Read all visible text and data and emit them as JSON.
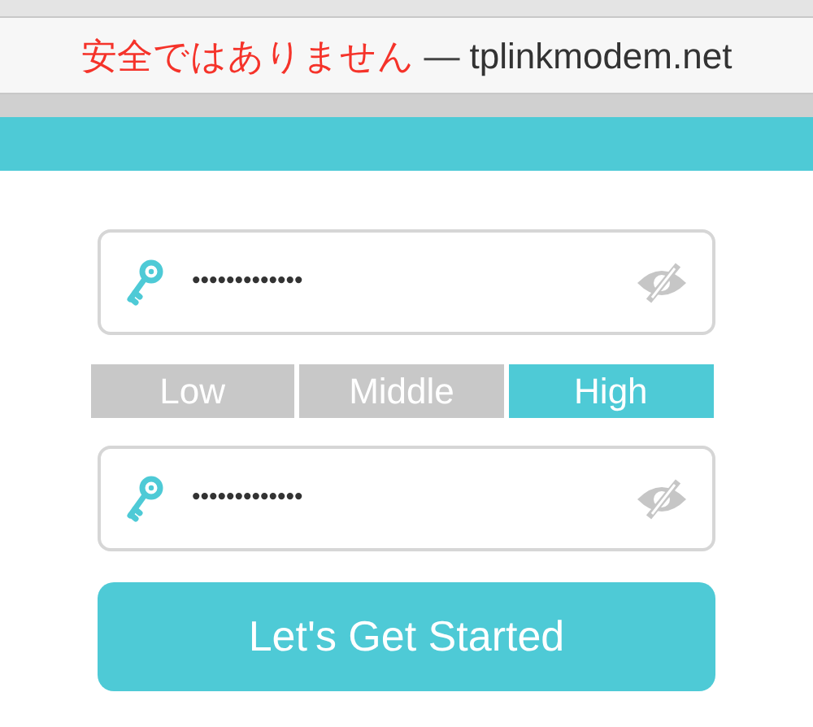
{
  "address_bar": {
    "warning": "安全ではありません",
    "separator": "—",
    "domain": "tplinkmodem.net"
  },
  "password_fields": [
    {
      "value": "•••••••••••••",
      "visible": false
    },
    {
      "value": "•••••••••••••",
      "visible": false
    }
  ],
  "strength_levels": [
    {
      "label": "Low",
      "selected": false
    },
    {
      "label": "Middle",
      "selected": false
    },
    {
      "label": "High",
      "selected": true
    }
  ],
  "button": "Let's Get Started"
}
